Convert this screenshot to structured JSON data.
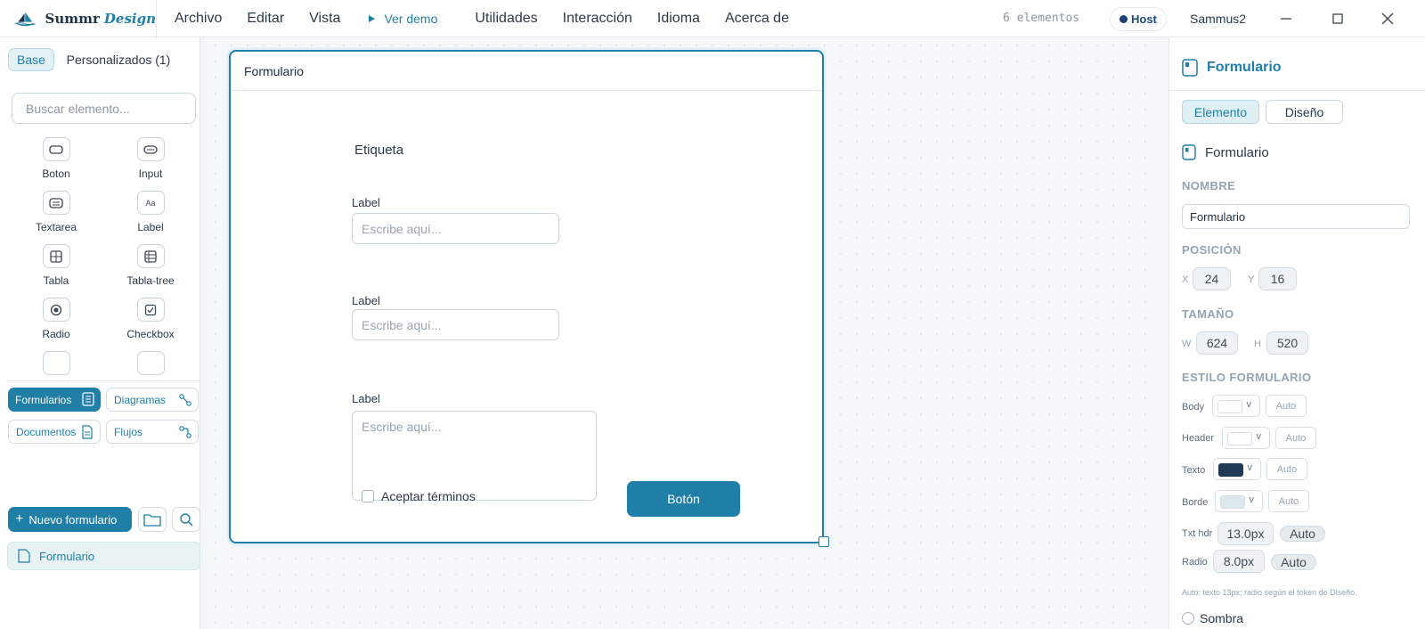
{
  "app": {
    "brand_main": "Summr",
    "brand_accent": "Design"
  },
  "menu": {
    "archivo": "Archivo",
    "editar": "Editar",
    "vista": "Vista",
    "demo": "Ver demo",
    "utilidades": "Utilidades",
    "interaccion": "Interacción",
    "idioma": "Idioma",
    "acerca": "Acerca de"
  },
  "status": {
    "count": "6 elementos",
    "host": "Host",
    "user": "Sammus2"
  },
  "sidebar": {
    "tab_base": "Base",
    "tab_custom": "Personalizados (1)",
    "search_placeholder": "Buscar elemento...",
    "palette": [
      {
        "label": "Boton",
        "icon": "button-icon"
      },
      {
        "label": "Input",
        "icon": "input-icon"
      },
      {
        "label": "Textarea",
        "icon": "textarea-icon"
      },
      {
        "label": "Label",
        "icon": "label-icon"
      },
      {
        "label": "Tabla",
        "icon": "table-icon"
      },
      {
        "label": "Tabla-tree",
        "icon": "table-tree-icon"
      },
      {
        "label": "Radio",
        "icon": "radio-icon"
      },
      {
        "label": "Checkbox",
        "icon": "checkbox-icon"
      }
    ],
    "categories": {
      "formularios": "Formularios",
      "diagramas": "Diagramas",
      "documentos": "Documentos",
      "flujos": "Flujos"
    },
    "new_form": "Nuevo formulario",
    "files": [
      {
        "label": "Formulario"
      }
    ]
  },
  "canvas": {
    "form": {
      "title": "Formulario",
      "etiqueta": "Etiqueta",
      "fields": [
        {
          "label": "Label",
          "placeholder": "Escribe aquí..."
        },
        {
          "label": "Label",
          "placeholder": "Escribe aquí..."
        },
        {
          "label": "Label",
          "placeholder": "Escribe aquí..."
        }
      ],
      "checkbox": "Aceptar términos",
      "button": "Botón"
    }
  },
  "panel": {
    "title": "Formulario",
    "tab_elemento": "Elemento",
    "tab_diseno": "Diseño",
    "element_name": "Formulario",
    "nombre_label": "NOMBRE",
    "nombre_value": "Formulario",
    "posicion_label": "POSICIÓN",
    "pos_x_label": "X",
    "pos_x": "24",
    "pos_y_label": "Y",
    "pos_y": "16",
    "tamano_label": "TAMAÑO",
    "size_w_label": "W",
    "size_w": "624",
    "size_h_label": "H",
    "size_h": "520",
    "estilo_label": "ESTILO FORMULARIO",
    "styles": [
      {
        "label": "Body",
        "auto": "Auto",
        "color": "#ffffff",
        "arrow": "v"
      },
      {
        "label": "Header",
        "auto": "Auto",
        "color": "#ffffff",
        "arrow": "v"
      },
      {
        "label": "Texto",
        "auto": "Auto",
        "color": "#1f3a52",
        "arrow": "v"
      },
      {
        "label": "Borde",
        "auto": "Auto",
        "color": "#dde8ec",
        "arrow": "v"
      }
    ],
    "txthdr_label": "Txt hdr",
    "txthdr_value": "13.0px",
    "txthdr_auto": "Auto",
    "radio_label": "Radio",
    "radio_value": "8.0px",
    "radio_auto": "Auto",
    "hint": "Auto: texto 13px; radio según el token de Diseño.",
    "sombra": "Sombra"
  },
  "colors": {
    "accent": "#1f7fa6",
    "selection": "#e3f1f4"
  }
}
